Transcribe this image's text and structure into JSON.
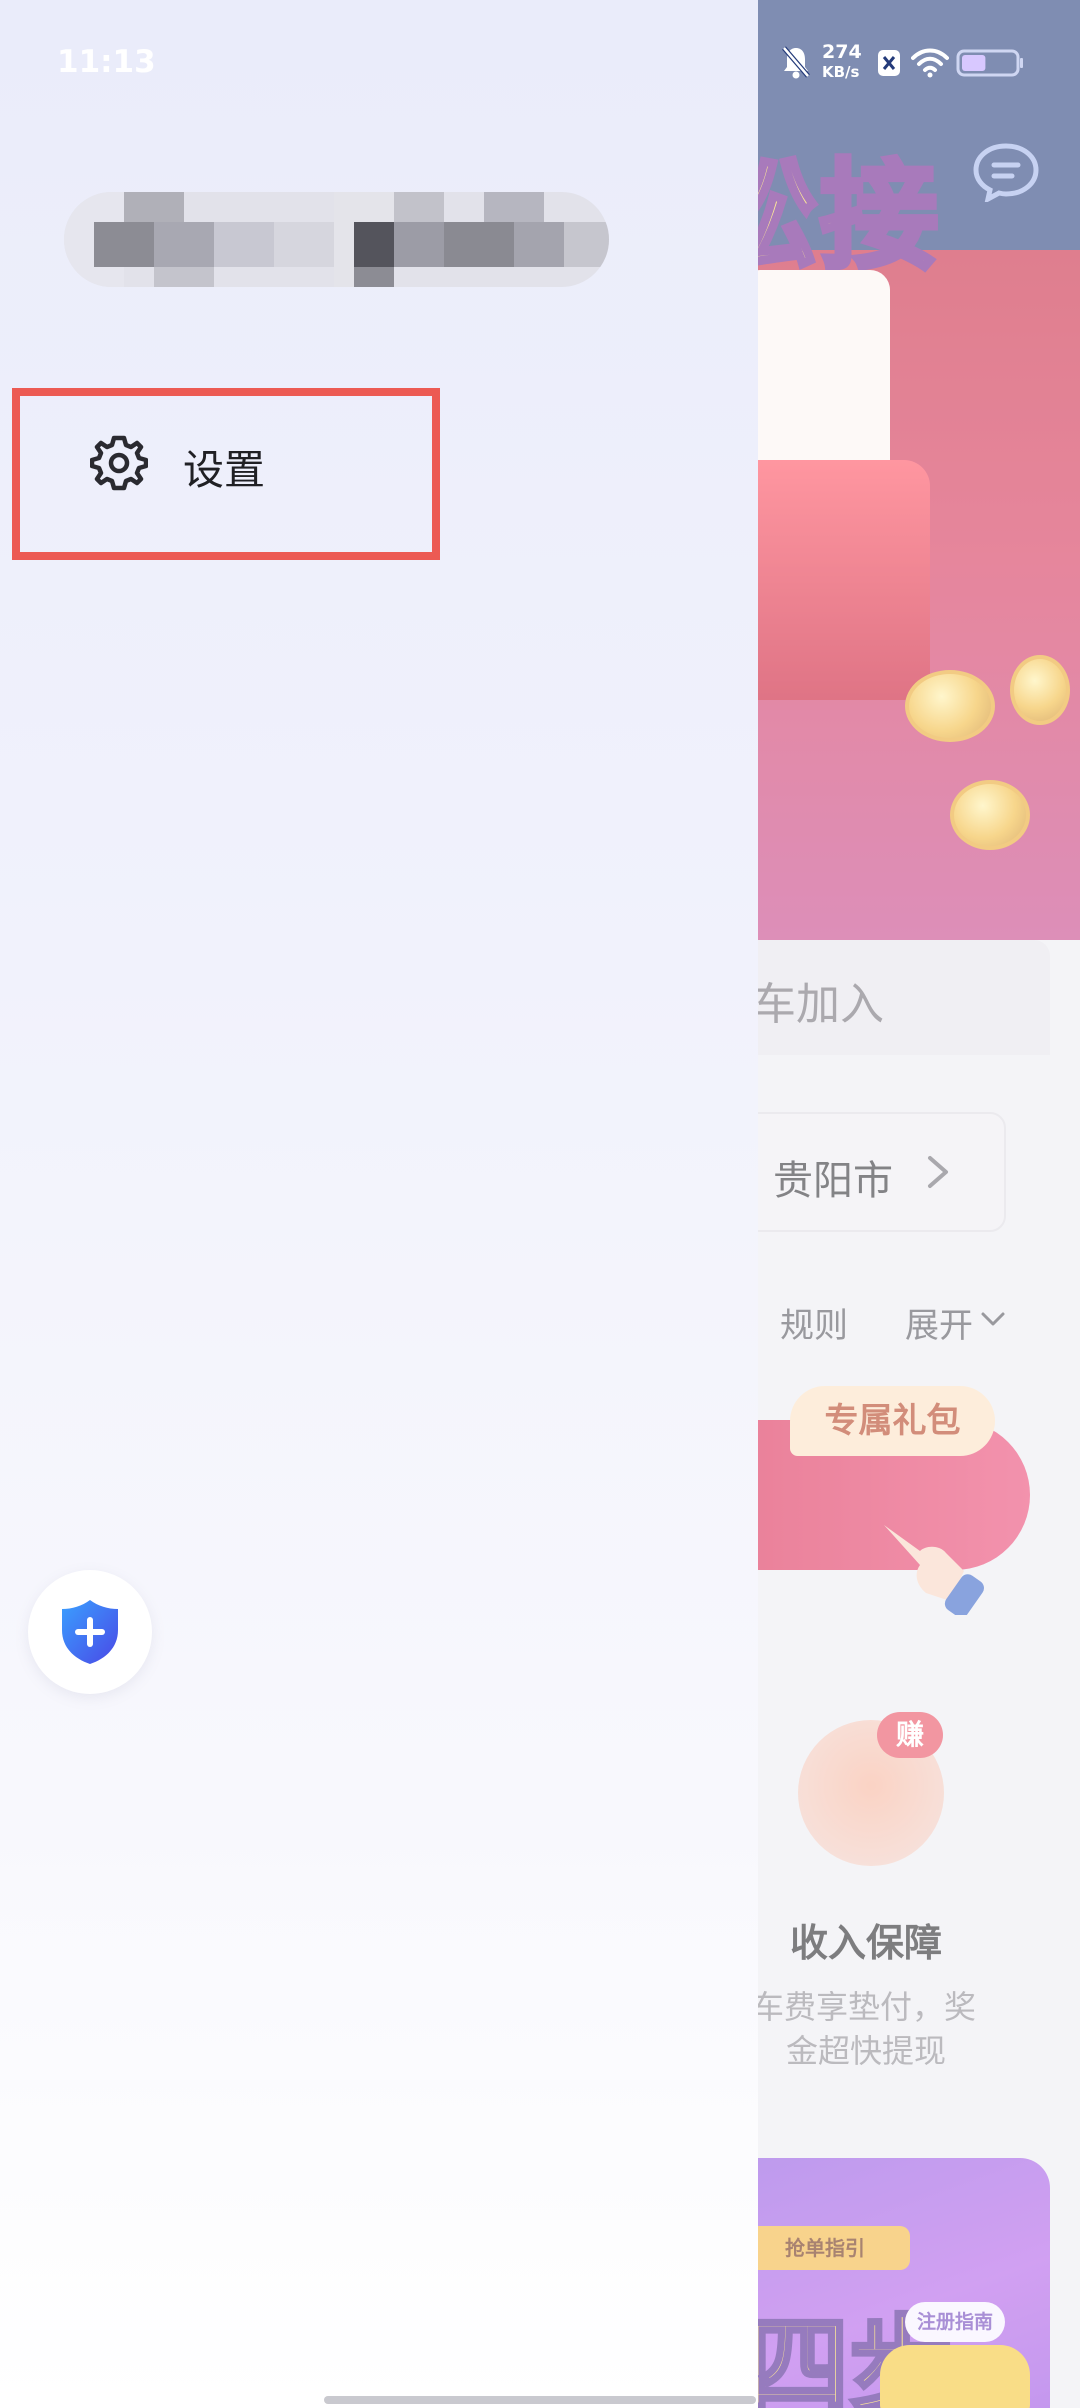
{
  "status_bar": {
    "time": "11:13",
    "net_speed_value": "274",
    "net_speed_unit": "KB/s",
    "icons": [
      "bell-muted-icon",
      "sim-x-icon",
      "wifi-icon",
      "battery-icon"
    ],
    "battery_level": 0.45
  },
  "drawer": {
    "settings_label": "设置",
    "settings_icon": "gear-icon",
    "shield_icon": "shield-plus-icon",
    "colors": {
      "highlight_border": "#ec5a53",
      "shield_blue": "#3f5ff0"
    }
  },
  "background_app": {
    "header_icon": "chat-bubble-icon",
    "hero_title": "松接",
    "join_text": "车加入",
    "city": "贵阳市",
    "rules_label": "规则",
    "expand_label": "展开",
    "gift_tag": "专属礼包",
    "income_badge": "赚",
    "income_title": "收入保障",
    "income_desc_line1": "车费享垫付，奖",
    "income_desc_line2": "金超快提现",
    "promo_ribbon": "抢单指引",
    "promo_big_text": "四步",
    "promo_tag": "注册指南",
    "colors": {
      "header": "#243b7a",
      "hero": "#c8223d",
      "promo": "#8c52e0"
    }
  }
}
